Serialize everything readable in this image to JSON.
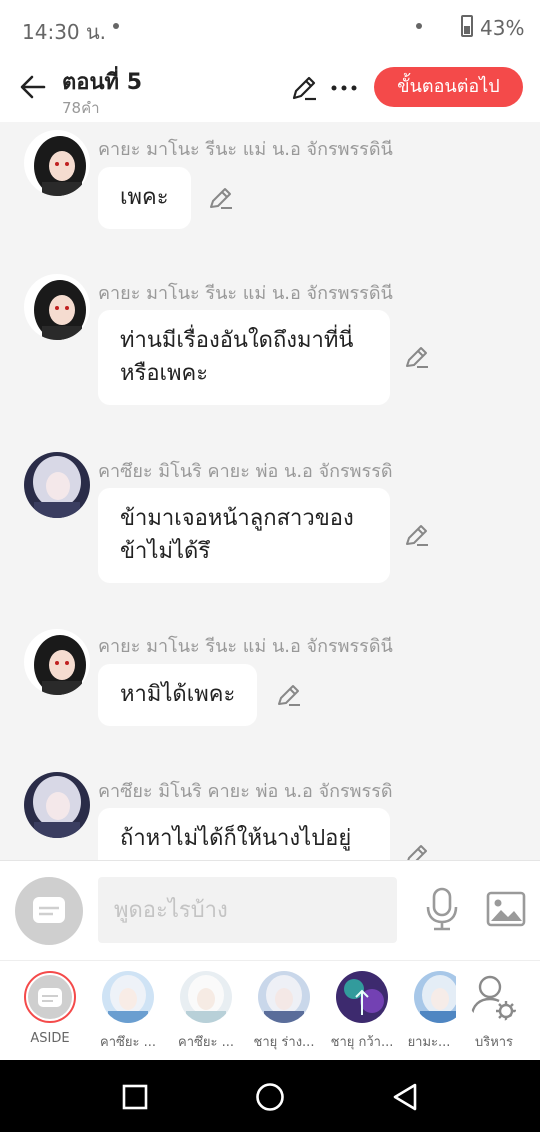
{
  "status": {
    "time": "14:30 น.",
    "battery": "43%"
  },
  "header": {
    "title": "ตอนที่ 5",
    "word_count": "78คำ",
    "next_label": "ขั้นตอนต่อไป"
  },
  "messages": [
    {
      "name": "คายะ มาโนะ รีนะ แม่ น.อ จักรพรรดินี",
      "text": "เพคะ"
    },
    {
      "name": "คายะ มาโนะ รีนะ แม่ น.อ จักรพรรดินี",
      "text": "ท่านมีเรื่องอันใดถึงมาที่นี่หรือเพคะ"
    },
    {
      "name": "คาซึยะ มิโนริ คายะ พ่อ น.อ จักรพรรดิ",
      "text": "ข้ามาเจอหน้าลูกสาวของข้าไม่ได้รึ"
    },
    {
      "name": "คายะ มาโนะ รีนะ แม่ น.อ จักรพรรดินี",
      "text": "หามิได้เพคะ"
    },
    {
      "name": "คาซึยะ มิโนริ คายะ พ่อ น.อ จักรพรรดิ",
      "text": "ถ้าหาไม่ได้ก็ให้นางไปอยู่"
    }
  ],
  "input": {
    "placeholder": "พูดอะไรบ้าง"
  },
  "characters": [
    {
      "label": "ASIDE"
    },
    {
      "label": "คาซึยะ ..."
    },
    {
      "label": "คาซึยะ ..."
    },
    {
      "label": "ชายุ ร่าง..."
    },
    {
      "label": "ชายุ กว้า..."
    },
    {
      "label": "ยามะ..."
    },
    {
      "label": "บริหาร"
    }
  ],
  "colors": {
    "accent": "#f44a4a"
  }
}
